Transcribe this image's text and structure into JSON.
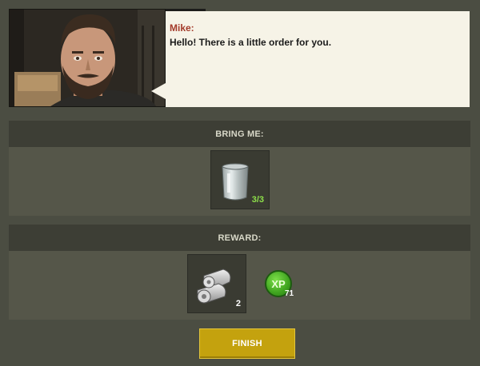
{
  "dialog": {
    "speaker": "Mike:",
    "message": "Hello! There is a little order for you."
  },
  "bring_me": {
    "title": "BRING ME:",
    "items": [
      {
        "icon": "glass-jar-icon",
        "quantity": "3/3",
        "quantity_color": "#8ee04a"
      }
    ]
  },
  "reward": {
    "title": "REWARD:",
    "items": [
      {
        "icon": "cloth-rolls-icon",
        "quantity": "2",
        "quantity_color": "#ffffff"
      }
    ],
    "xp": {
      "label": "XP",
      "value": "71"
    }
  },
  "finish_label": "FINISH",
  "colors": {
    "background": "#4b4d42",
    "header": "#3d3e35",
    "button": "#c4a20e",
    "xp_green": "#3fa31f",
    "speaker": "#a33a2a"
  }
}
